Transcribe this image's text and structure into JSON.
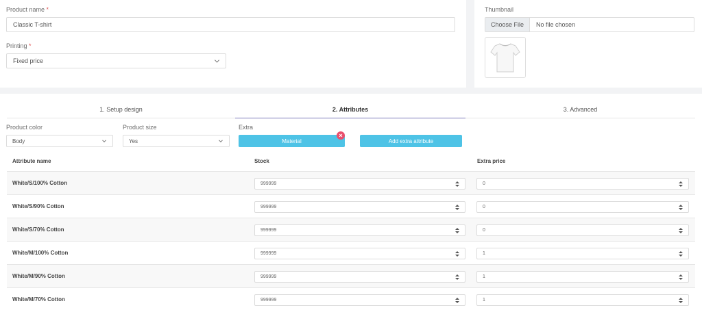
{
  "product_name": {
    "label": "Product name",
    "required_mark": "*",
    "value": "Classic T-shirt"
  },
  "printing": {
    "label": "Printing",
    "required_mark": "*",
    "value": "Fixed price"
  },
  "thumbnail": {
    "label": "Thumbnail",
    "choose_label": "Choose File",
    "status": "No file chosen",
    "image_icon": "tshirt-icon"
  },
  "tabs": [
    {
      "label": "1. Setup design"
    },
    {
      "label": "2. Attributes",
      "active": true
    },
    {
      "label": "3. Advanced"
    }
  ],
  "attributes": {
    "color_label": "Product color",
    "color_value": "Body",
    "size_label": "Product size",
    "size_value": "Yes",
    "extra_label": "Extra",
    "extra_chip": "Material",
    "add_button": "Add extra attribute",
    "remove_icon": "close-icon",
    "accent": "#4ec3e6",
    "remove_color": "#ea4f6c"
  },
  "table": {
    "headers": [
      "Attribute name",
      "Stock",
      "Extra price"
    ],
    "rows": [
      {
        "name": "White/S/100% Cotton",
        "stock": "999999",
        "price": "0"
      },
      {
        "name": "White/S/90% Cotton",
        "stock": "999999",
        "price": "0"
      },
      {
        "name": "White/S/70% Cotton",
        "stock": "999999",
        "price": "0"
      },
      {
        "name": "White/M/100% Cotton",
        "stock": "999999",
        "price": "1"
      },
      {
        "name": "White/M/90% Cotton",
        "stock": "999999",
        "price": "1"
      },
      {
        "name": "White/M/70% Cotton",
        "stock": "999999",
        "price": "1"
      }
    ]
  }
}
